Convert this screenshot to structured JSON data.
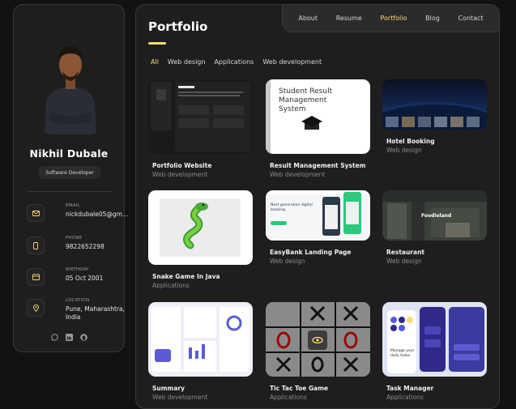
{
  "profile": {
    "name": "Nikhil Dubale",
    "role": "Software Developer"
  },
  "contacts": [
    {
      "label": "EMAIL",
      "value": "nickdubale05@gm...",
      "icon": "mail-icon"
    },
    {
      "label": "PHONE",
      "value": "9822652298",
      "icon": "phone-icon"
    },
    {
      "label": "BIRTHDAY",
      "value": "05 Oct 2001",
      "icon": "calendar-icon"
    },
    {
      "label": "LOCATION",
      "value": "Pune, Maharashtra, India",
      "icon": "location-icon"
    }
  ],
  "socials": [
    "whatsapp-icon",
    "linkedin-icon",
    "github-icon"
  ],
  "nav": [
    {
      "label": "About",
      "active": false
    },
    {
      "label": "Resume",
      "active": false
    },
    {
      "label": "Portfolio",
      "active": true
    },
    {
      "label": "Blog",
      "active": false
    },
    {
      "label": "Contact",
      "active": false
    }
  ],
  "page": {
    "title": "Portfolio"
  },
  "filters": [
    {
      "label": "All",
      "active": true
    },
    {
      "label": "Web design",
      "active": false
    },
    {
      "label": "Applications",
      "active": false
    },
    {
      "label": "Web development",
      "active": false
    }
  ],
  "projects": [
    {
      "title": "Portfolio Website",
      "category": "Web development"
    },
    {
      "title": "Result Management System",
      "category": "Web development",
      "thumb_text": "Student Result Management System"
    },
    {
      "title": "Hotel Booking",
      "category": "Web design"
    },
    {
      "title": "Snake Game In Java",
      "category": "Applications"
    },
    {
      "title": "EasyBank Landing Page",
      "category": "Web design",
      "thumb_text": "Next generation digital banking"
    },
    {
      "title": "Restaurant",
      "category": "Web design",
      "thumb_text": "Foodieland"
    },
    {
      "title": "Summary",
      "category": "Web development"
    },
    {
      "title": "Tic Tac Toe Game",
      "category": "Applications"
    },
    {
      "title": "Task Manager",
      "category": "Applications",
      "thumb_text": "Manage your daily tasks"
    }
  ],
  "colors": {
    "accent": "#ffdb70",
    "background": "#121212",
    "panel": "#1e1e1f"
  }
}
